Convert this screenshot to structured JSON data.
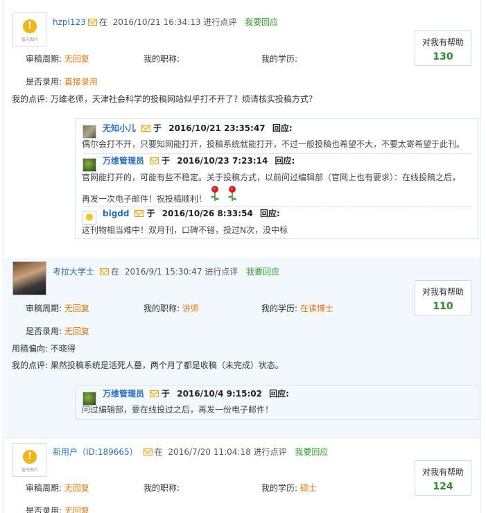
{
  "labels": {
    "review_cycle": "审稿周期:",
    "my_title": "我的职称:",
    "my_education": "我的学历:",
    "accepted": "是否录用:",
    "my_comment": "我的点评:",
    "preference": "用稿偏向:",
    "at": "在",
    "commented": "进行点评",
    "reply_link": "我要回应",
    "helpful": "对我有帮助",
    "yu": "于",
    "reply_suffix": "回应:"
  },
  "comments": [
    {
      "user": "hzpl123",
      "date": "2016/10/21 16:34:13",
      "helpful_count": "130",
      "review_cycle": "无回复",
      "title": "",
      "education": "",
      "accepted": "直接录用",
      "comment": "万维老师，天津社会科学的投稿网站似乎打不开了？烦请核实投稿方式？",
      "avatar_caption": "暂无图片",
      "replies": [
        {
          "user": "无知小儿",
          "date": "2016/10/21 23:35:47",
          "lines": [
            "偶尔会打不开，只要知网能打开，投稿系统就能打开，不过一般投稿也希望不大，不要太寄希望于此刊。"
          ]
        },
        {
          "user": "万维管理员",
          "date": "2016/10/23 7:23:14",
          "lines": [
            "官网能打开的，可能有些不稳定。关于投稿方式，以前问过编辑部（官网上也有要求）：在线投稿之后，",
            "再发一次电子邮件！祝投稿顺利！"
          ]
        },
        {
          "user": "bigdd",
          "date": "2016/10/26 8:33:54",
          "lines": [
            "这刊物相当难中！双月刊，口碑不错，投过N次，没中标"
          ]
        }
      ]
    },
    {
      "user": "考拉大学士",
      "date": "2016/9/1 15:30:47",
      "helpful_count": "110",
      "review_cycle": "无回复",
      "title": "讲师",
      "education": "在读博士",
      "accepted": "无回复",
      "preference": "不晓得",
      "comment": "果然投稿系统是活死人墓，两个月了都是收稿（未完成）状态。",
      "replies": [
        {
          "user": "万维管理员",
          "date": "2016/10/4 9:15:02",
          "lines": [
            "问过编辑部，要在线投过之后，再发一份电子邮件！"
          ]
        }
      ]
    },
    {
      "user": "新用户（ID:189665）",
      "date": "2016/7/20 11:04:18",
      "helpful_count": "124",
      "review_cycle": "无回复",
      "title": "",
      "education": "硕士",
      "accepted": "无回复",
      "avatar_caption": "暂无图片"
    }
  ]
}
